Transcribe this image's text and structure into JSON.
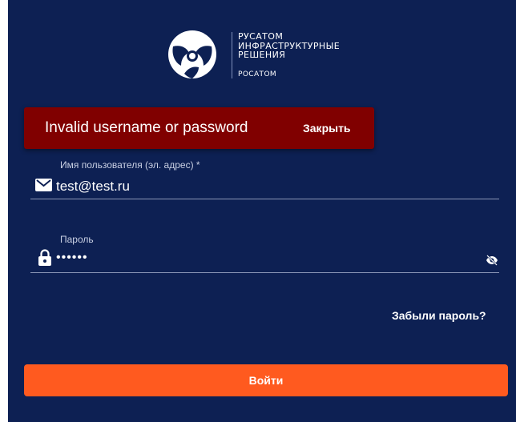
{
  "brand": {
    "name_lines": [
      "РУСАТОМ",
      "ИНФРАСТРУКТУРНЫЕ",
      "РЕШЕНИЯ"
    ],
    "sub": "РОСАТОМ"
  },
  "alert": {
    "message": "Invalid username or password",
    "close_label": "Закрыть"
  },
  "form": {
    "username": {
      "label": "Имя пользователя (эл. адрес) *",
      "value": "test@test.ru",
      "icon": "envelope-icon"
    },
    "password": {
      "label": "Пароль",
      "value": "••••••",
      "icon": "lock-icon",
      "toggle_icon": "eye-off-icon"
    },
    "forgot_label": "Забыли пароль?",
    "submit_label": "Войти"
  },
  "colors": {
    "background": "#0d2053",
    "alert": "#800000",
    "accent": "#ff5a1f"
  }
}
